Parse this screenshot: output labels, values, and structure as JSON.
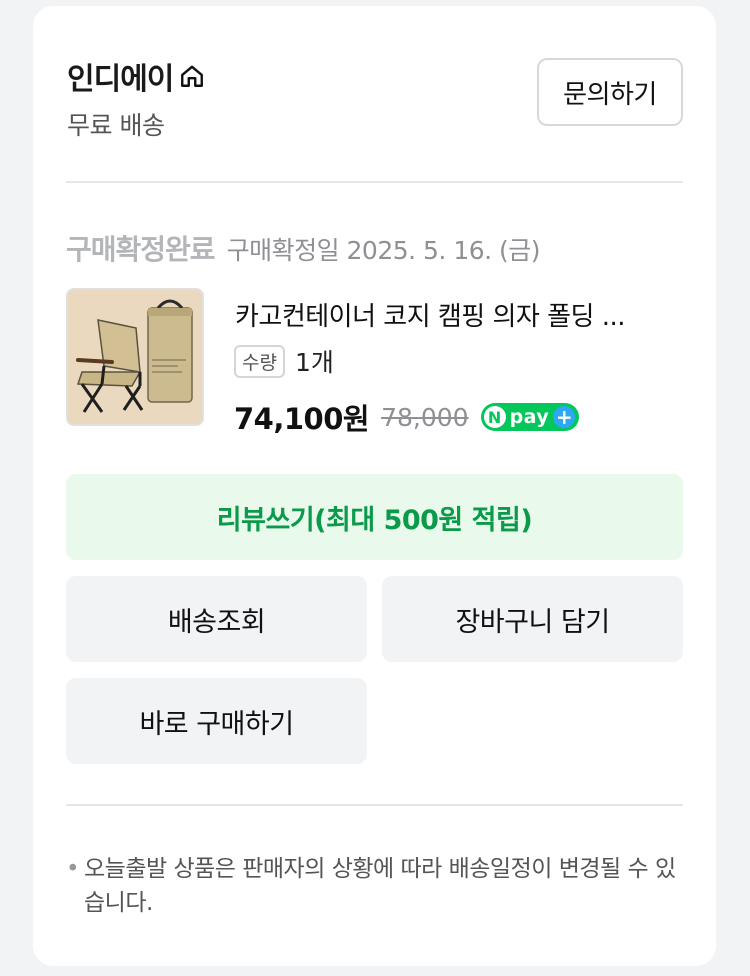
{
  "seller": {
    "name": "인디에이",
    "shipping": "무료 배송",
    "inquiry_label": "문의하기"
  },
  "order": {
    "status": "구매확정완료",
    "confirmed_date": "구매확정일 2025. 5. 16. (금)"
  },
  "product": {
    "name": "카고컨테이너 코지 캠핑 의자 폴딩 ...",
    "qty_label": "수량",
    "qty_value": "1개",
    "price": "74,100원",
    "original_price": "78,000",
    "npay": {
      "n": "N",
      "pay": "pay",
      "plus": "+"
    }
  },
  "actions": {
    "review": "리뷰쓰기(최대 500원 적립)",
    "track": "배송조회",
    "cart": "장바구니 담기",
    "buy_now": "바로 구매하기"
  },
  "notice": {
    "bullet": "•",
    "text": "오늘출발 상품은 판매자의 상황에 따라 배송일정이 변경될 수 있습니다."
  },
  "colors": {
    "accent_green": "#03c75a",
    "review_bg": "#e9f9ec",
    "review_text": "#0a9a4a",
    "npay_plus": "#2ea8f5"
  },
  "icons": {
    "home": "home-icon",
    "product_image": "camping-chair-image"
  }
}
